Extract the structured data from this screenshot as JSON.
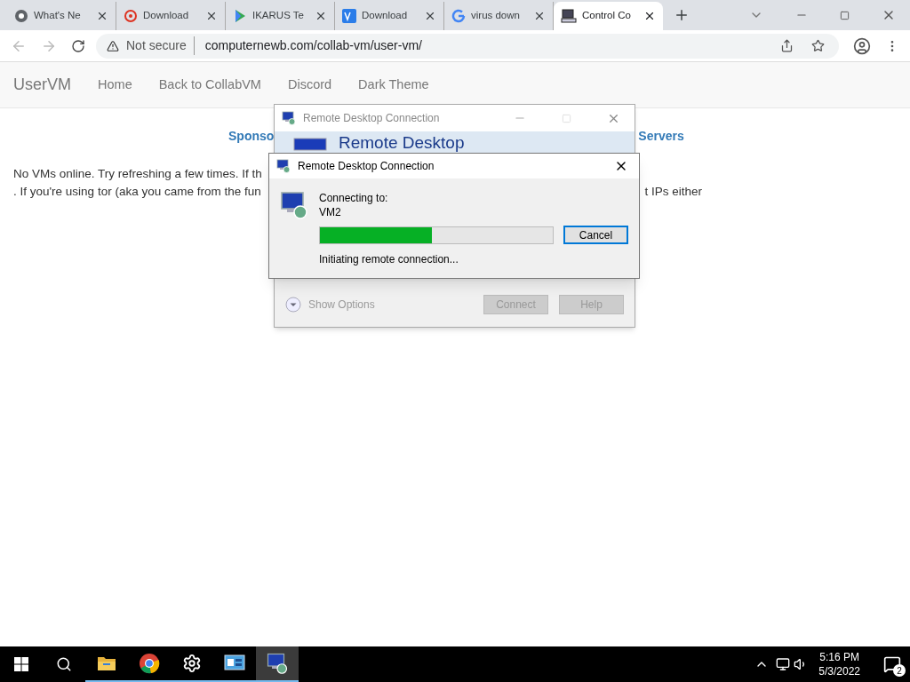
{
  "browser": {
    "tabs": [
      {
        "title": "What's Ne",
        "kind": "chrome",
        "selected": false
      },
      {
        "title": "Download",
        "kind": "target",
        "selected": false
      },
      {
        "title": "IKARUS Te",
        "kind": "play",
        "selected": false
      },
      {
        "title": "Download",
        "kind": "square",
        "selected": false
      },
      {
        "title": "virus down",
        "kind": "google",
        "selected": false
      },
      {
        "title": "Control Co",
        "kind": "computer",
        "selected": true
      }
    ],
    "security": "Not secure",
    "url": "computernewb.com/collab-vm/user-vm/"
  },
  "site": {
    "brand": "UserVM",
    "nav": [
      "Home",
      "Back to CollabVM",
      "Discord",
      "Dark Theme"
    ],
    "heading_left": "Sponso",
    "heading_right": "Servers",
    "line_1": "No VMs online. Try refreshing a few times. If th",
    "line_2_left": ". If you're using tor (aka you came from the fun",
    "line_2_right": "t IPs either"
  },
  "back_window": {
    "title": "Remote Desktop Connection",
    "banner": "Remote Desktop",
    "show_options": "Show Options",
    "buttons": [
      {
        "label": "Connect",
        "disabled": true
      },
      {
        "label": "Help",
        "disabled": true
      }
    ]
  },
  "dialog": {
    "title": "Remote Desktop Connection",
    "connecting_label": "Connecting to:",
    "target": "VM2",
    "progress": {
      "level": 0.48
    },
    "status": "Initiating remote connection...",
    "button": "Cancel"
  },
  "taskbar": {
    "apps": [
      {
        "kind": "folder",
        "open": true,
        "selected": false
      },
      {
        "kind": "chrome",
        "open": true,
        "selected": false
      },
      {
        "kind": "gear",
        "open": true,
        "selected": false
      },
      {
        "kind": "panel",
        "open": true,
        "selected": false
      },
      {
        "kind": "rdp",
        "open": true,
        "selected": true
      }
    ],
    "time": "5:16 PM",
    "date": "5/3/2022",
    "notifications": "2"
  }
}
